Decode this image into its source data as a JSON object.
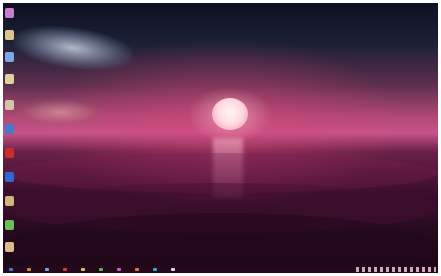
{
  "desktop": {
    "icons": [
      {
        "name": "desktop-icon-1",
        "color": "#c77bd1"
      },
      {
        "name": "desktop-icon-2",
        "color": "#d9c58a"
      },
      {
        "name": "desktop-icon-3",
        "color": "#7aa7e6"
      },
      {
        "name": "desktop-icon-4",
        "color": "#e0d2a0"
      },
      {
        "name": "desktop-icon-5",
        "color": "#d6c2a6"
      },
      {
        "name": "desktop-icon-6",
        "color": "#4b78c9"
      },
      {
        "name": "desktop-icon-7",
        "color": "#cc2b2b"
      },
      {
        "name": "desktop-icon-8",
        "color": "#2f68d6"
      },
      {
        "name": "desktop-icon-9",
        "color": "#d1b57a"
      },
      {
        "name": "desktop-icon-10",
        "color": "#6dbb5a"
      },
      {
        "name": "desktop-icon-11",
        "color": "#d8bc8e"
      }
    ]
  },
  "taskbar": {
    "items": [
      {
        "name": "start-button",
        "color": "#3b7bd4"
      },
      {
        "name": "taskbar-app-1",
        "color": "#d08a3a"
      },
      {
        "name": "taskbar-app-2",
        "color": "#6da7e0"
      },
      {
        "name": "taskbar-app-3",
        "color": "#d33b3b"
      },
      {
        "name": "taskbar-app-4",
        "color": "#e0c04a"
      },
      {
        "name": "taskbar-app-5",
        "color": "#5fb35f"
      },
      {
        "name": "taskbar-app-6",
        "color": "#c35ad1"
      },
      {
        "name": "taskbar-app-7",
        "color": "#e07a3a"
      },
      {
        "name": "taskbar-app-8",
        "color": "#3aa6c9"
      },
      {
        "name": "taskbar-app-9",
        "color": "#d9d9d9"
      }
    ],
    "tray_color": "#c9a9c0"
  }
}
